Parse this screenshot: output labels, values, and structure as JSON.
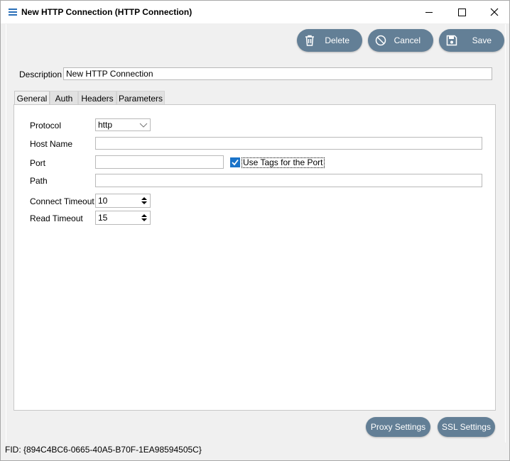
{
  "window": {
    "title": "New HTTP Connection (HTTP Connection)"
  },
  "toolbar": {
    "delete_label": "Delete",
    "cancel_label": "Cancel",
    "save_label": "Save"
  },
  "description": {
    "label": "Description",
    "value": "New HTTP Connection"
  },
  "tabs": [
    {
      "label": "General",
      "active": true
    },
    {
      "label": "Auth",
      "active": false
    },
    {
      "label": "Headers",
      "active": false
    },
    {
      "label": "Parameters",
      "active": false
    }
  ],
  "general": {
    "protocol_label": "Protocol",
    "protocol_value": "http",
    "host_label": "Host Name",
    "host_value": "",
    "port_label": "Port",
    "port_value": "",
    "use_tags_label": "Use Tags for the Port",
    "use_tags_checked": true,
    "path_label": "Path",
    "path_value": "",
    "connect_timeout_label": "Connect Timeout",
    "connect_timeout_value": "10",
    "read_timeout_label": "Read Timeout",
    "read_timeout_value": "15"
  },
  "footer": {
    "proxy_label": "Proxy Settings",
    "ssl_label": "SSL Settings",
    "fid_text": "FID: {894C4BC6-0665-40A5-B70F-1EA98594505C}"
  },
  "colors": {
    "button_bg": "#637f96",
    "accent": "#1a73c9"
  }
}
